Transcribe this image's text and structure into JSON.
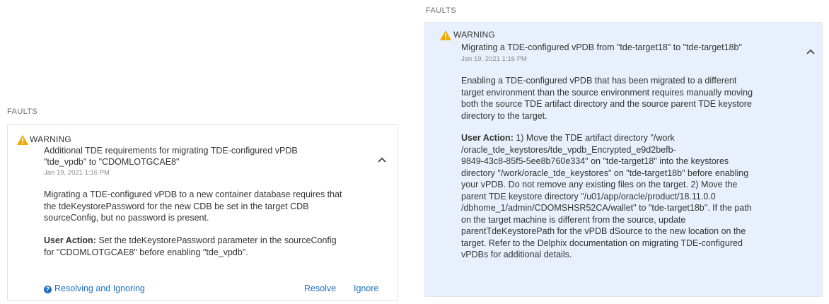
{
  "left_panel": {
    "section_title": "FAULTS",
    "severity": "WARNING",
    "icon": "warning-triangle-icon",
    "title_line1": "Additional TDE requirements for migrating TDE-configured vPDB",
    "title_line2": "\"tde_vpdb\" to \"CDOMLOTGCAE8\"",
    "date": "Jan 19, 2021 1:16 PM",
    "description_lines": [
      "Migrating a TDE-configured vPDB to a new container database requires that",
      "the tdeKeystorePassword for the new CDB be set in the target CDB",
      "sourceConfig, but no password is present."
    ],
    "user_action_label": "User Action:",
    "user_action_line1": "Set the tdeKeystorePassword parameter in the sourceConfig",
    "user_action_line2": "for \"CDOMLOTGCAE8\" before enabling \"tde_vpdb\".",
    "help_link": "Resolving and Ignoring",
    "resolve_label": "Resolve",
    "ignore_label": "Ignore"
  },
  "right_panel": {
    "section_title": "FAULTS",
    "severity": "WARNING",
    "icon": "warning-triangle-icon",
    "title": "Migrating a TDE-configured vPDB from \"tde-target18\" to \"tde-target18b\"",
    "date": "Jan 19, 2021 1:16 PM",
    "description_lines": [
      "Enabling a TDE-configured vPDB that has been migrated to a different",
      "target environment than the source environment requires manually moving",
      "both the source TDE artifact directory and the source parent TDE keystore",
      "directory to the target."
    ],
    "user_action_label": "User Action:",
    "user_action_lines": [
      "1) Move the TDE artifact directory \"/work",
      "/oracle_tde_keystores/tde_vpdb_Encrypted_e9d2befb-",
      "9849-43c8-85f5-5ee8b760e334\" on \"tde-target18\" into the keystores",
      "directory \"/work/oracle_tde_keystores\" on \"tde-target18b\" before enabling",
      "your vPDB. Do not remove any existing files on the target. 2) Move the",
      "parent TDE keystore directory \"/u01/app/oracle/product/18.11.0.0",
      "/dbhome_1/admin/CDOMSHSR52CA/wallet\" to \"tde-target18b\". If the path",
      "on the target machine is different from the source, update",
      "parentTdeKeystorePath for the vPDB dSource to the new location on the",
      "target. Refer to the Delphix documentation on migrating TDE-configured",
      "vPDBs for additional details."
    ]
  },
  "colors": {
    "warning": "#f2a900",
    "link": "#1b6fc5",
    "selected_card_bg": "#e8f1fb"
  }
}
